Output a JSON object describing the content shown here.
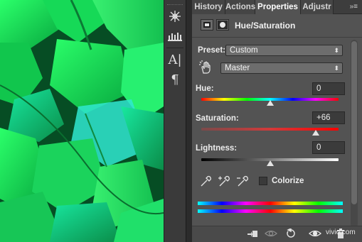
{
  "tabs": [
    "History",
    "Actions",
    "Properties",
    "Adjustr"
  ],
  "active_tab": "Properties",
  "panel": {
    "title": "Hue/Saturation",
    "preset_label": "Preset:",
    "preset_value": "Custom",
    "channel_value": "Master",
    "hue": {
      "label": "Hue:",
      "value": "0"
    },
    "saturation": {
      "label": "Saturation:",
      "value": "+66"
    },
    "lightness": {
      "label": "Lightness:",
      "value": "0"
    },
    "colorize_label": "Colorize"
  },
  "toolstrip_icons": [
    "brush-settings-icon",
    "brush-presets-icon",
    "character-icon",
    "paragraph-icon"
  ],
  "tool_glyphs": {
    "character": "A|",
    "paragraph": "¶"
  },
  "footer_icons": [
    "clip-to-layer-icon",
    "visibility-icon",
    "reset-icon",
    "eye-icon",
    "delete-icon"
  ],
  "watermark": "vivio.com",
  "colors": {
    "panel_bg": "#535353",
    "tab_bar": "#3d3d3d",
    "canvas_green": "#12b84a"
  }
}
